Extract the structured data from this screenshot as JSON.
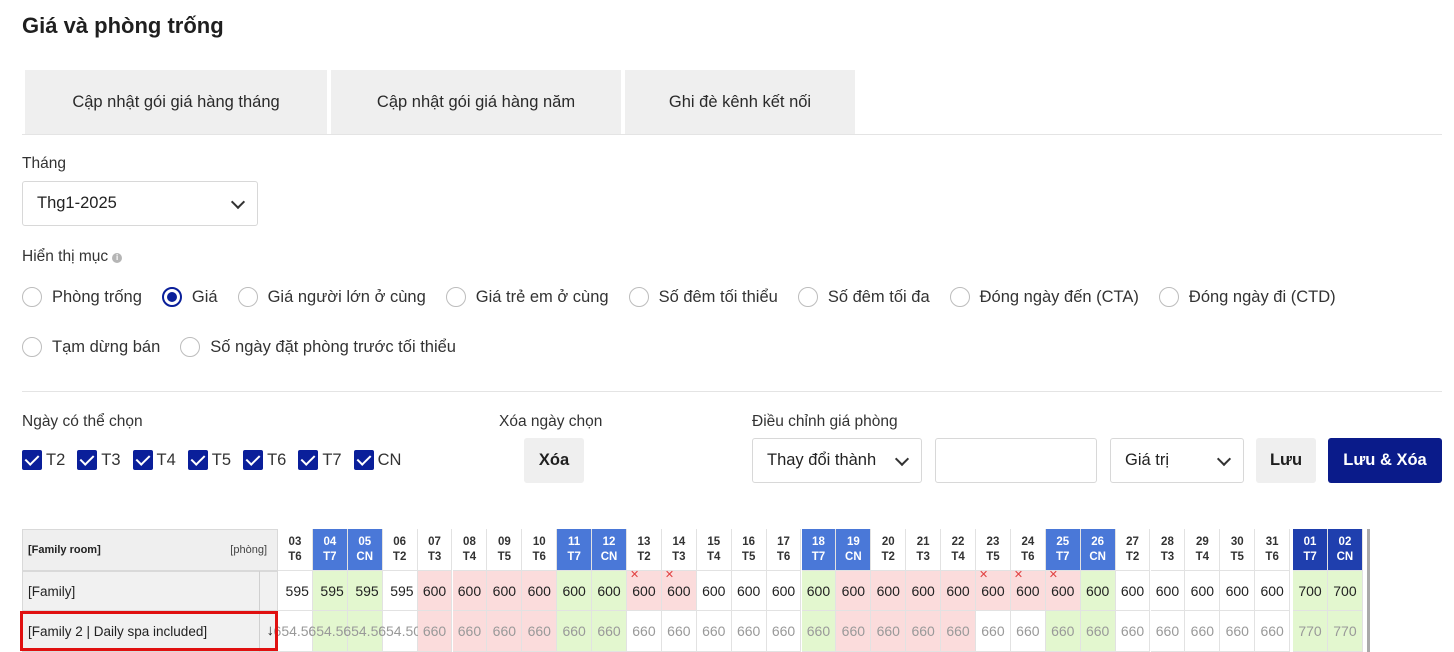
{
  "title": "Giá và phòng trống",
  "tabs": [
    "Cập nhật gói giá hàng tháng",
    "Cập nhật gói giá hàng năm",
    "Ghi đè kênh kết nối"
  ],
  "month": {
    "label": "Tháng",
    "value": "Thg1-2025"
  },
  "display": {
    "label": "Hiển thị mục",
    "options": [
      "Phòng trống",
      "Giá",
      "Giá người lớn ở cùng",
      "Giá trẻ em ở cùng",
      "Số đêm tối thiểu",
      "Số đêm tối đa",
      "Đóng ngày đến (CTA)",
      "Đóng ngày đi (CTD)",
      "Tạm dừng bán",
      "Số ngày đặt phòng trước tối thiểu"
    ],
    "selected": "Giá"
  },
  "days": {
    "label": "Ngày có thể chọn",
    "items": [
      "T2",
      "T3",
      "T4",
      "T5",
      "T6",
      "T7",
      "CN"
    ]
  },
  "clear": {
    "label": "Xóa ngày chọn",
    "button": "Xóa"
  },
  "adjust": {
    "label": "Điều chỉnh giá phòng",
    "mode": "Thay đổi thành",
    "value": "",
    "unit": "Giá trị",
    "save": "Lưu",
    "save_clear": "Lưu & Xóa"
  },
  "grid": {
    "room_name": "[Family room]",
    "unit": "[phòng]",
    "dates": [
      {
        "d": "03",
        "w": "T6"
      },
      {
        "d": "04",
        "w": "T7"
      },
      {
        "d": "05",
        "w": "CN"
      },
      {
        "d": "06",
        "w": "T2"
      },
      {
        "d": "07",
        "w": "T3"
      },
      {
        "d": "08",
        "w": "T4"
      },
      {
        "d": "09",
        "w": "T5"
      },
      {
        "d": "10",
        "w": "T6"
      },
      {
        "d": "11",
        "w": "T7"
      },
      {
        "d": "12",
        "w": "CN"
      },
      {
        "d": "13",
        "w": "T2"
      },
      {
        "d": "14",
        "w": "T3"
      },
      {
        "d": "15",
        "w": "T4"
      },
      {
        "d": "16",
        "w": "T5"
      },
      {
        "d": "17",
        "w": "T6"
      },
      {
        "d": "18",
        "w": "T7"
      },
      {
        "d": "19",
        "w": "CN"
      },
      {
        "d": "20",
        "w": "T2"
      },
      {
        "d": "21",
        "w": "T3"
      },
      {
        "d": "22",
        "w": "T4"
      },
      {
        "d": "23",
        "w": "T5"
      },
      {
        "d": "24",
        "w": "T6"
      },
      {
        "d": "25",
        "w": "T7"
      },
      {
        "d": "26",
        "w": "CN"
      },
      {
        "d": "27",
        "w": "T2"
      },
      {
        "d": "28",
        "w": "T3"
      },
      {
        "d": "29",
        "w": "T4"
      },
      {
        "d": "30",
        "w": "T5"
      },
      {
        "d": "31",
        "w": "T6"
      },
      {
        "d": "01",
        "w": "T7"
      },
      {
        "d": "02",
        "w": "CN"
      }
    ],
    "rows": [
      {
        "name": "[Family]",
        "values": [
          "595",
          "595",
          "595",
          "595",
          "600",
          "600",
          "600",
          "600",
          "600",
          "600",
          "600",
          "600",
          "600",
          "600",
          "600",
          "600",
          "600",
          "600",
          "600",
          "600",
          "600",
          "600",
          "600",
          "600",
          "600",
          "600",
          "600",
          "600",
          "600",
          "700",
          "700"
        ],
        "colors": [
          "w",
          "g",
          "g",
          "w",
          "r",
          "r",
          "r",
          "r",
          "g",
          "g",
          "r",
          "r",
          "w",
          "w",
          "w",
          "g",
          "r",
          "r",
          "r",
          "r",
          "r",
          "r",
          "r",
          "g",
          "w",
          "w",
          "w",
          "w",
          "w",
          "g",
          "g"
        ],
        "closed": [
          false,
          false,
          false,
          false,
          false,
          false,
          false,
          false,
          false,
          false,
          true,
          true,
          false,
          false,
          false,
          false,
          false,
          false,
          false,
          false,
          true,
          true,
          true,
          false,
          false,
          false,
          false,
          false,
          false,
          false,
          false
        ]
      },
      {
        "name": "[Family 2 | Daily spa included]",
        "values": [
          "654.50",
          "654.50",
          "654.50",
          "654.50",
          "660",
          "660",
          "660",
          "660",
          "660",
          "660",
          "660",
          "660",
          "660",
          "660",
          "660",
          "660",
          "660",
          "660",
          "660",
          "660",
          "660",
          "660",
          "660",
          "660",
          "660",
          "660",
          "660",
          "660",
          "660",
          "770",
          "770"
        ],
        "colors": [
          "w",
          "g",
          "g",
          "w",
          "r",
          "r",
          "r",
          "r",
          "g",
          "g",
          "w",
          "w",
          "w",
          "w",
          "w",
          "g",
          "r",
          "r",
          "r",
          "r",
          "w",
          "w",
          "g",
          "g",
          "w",
          "w",
          "w",
          "w",
          "w",
          "g",
          "g"
        ]
      }
    ]
  }
}
